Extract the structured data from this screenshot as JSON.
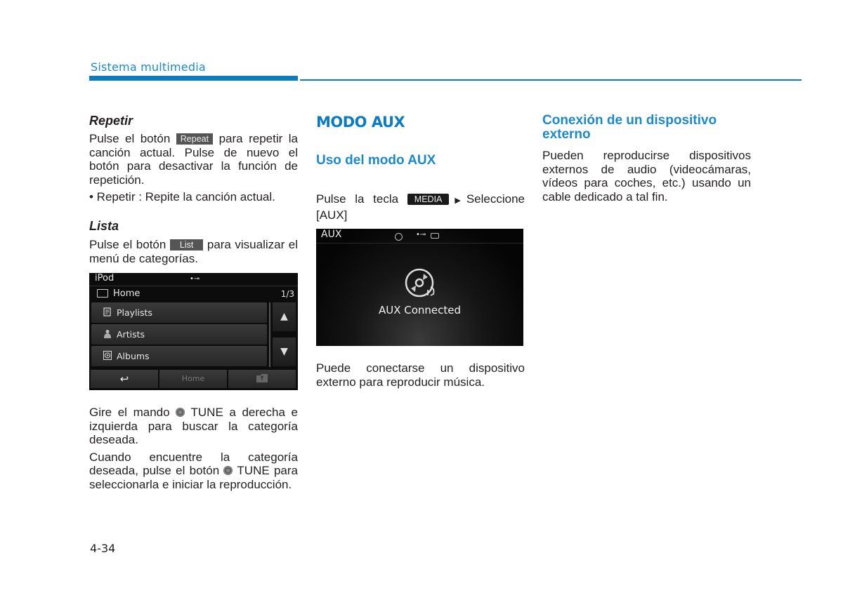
{
  "header": {
    "section_title": "Sistema multimedia",
    "accent_color": "#0a7cc2"
  },
  "left_column": {
    "repetir": {
      "heading": "Repetir",
      "text_before": "Pulse el botón",
      "button_label": "Repeat",
      "text_after": "para repetir la canción actual. Pulse de nuevo el botón para desactivar la función de repetición.",
      "bullet": "• Repetir : Repite la canción actual."
    },
    "lista": {
      "heading": "Lista",
      "text_before": "Pulse el botón",
      "button_label": "List",
      "text_after": "para visualizar el menú de categorías."
    },
    "ipod_screen": {
      "title": "iPod",
      "usb_icon": "usb-icon",
      "folder_label": "Home",
      "page_indicator": "1/3",
      "items": [
        {
          "label": "Playlists",
          "icon": "playlist-icon"
        },
        {
          "label": "Artists",
          "icon": "artist-icon"
        },
        {
          "label": "Albums",
          "icon": "album-icon"
        }
      ],
      "up_arrow": "▲",
      "down_arrow": "▼",
      "bottom_buttons": {
        "back": "↩",
        "home": "Home",
        "folder": "folder-up-icon"
      }
    },
    "gire": {
      "text_before": "Gire el mando",
      "knob": "TUNE",
      "text_after": "a derecha e izquierda para buscar la categoría deseada."
    },
    "cuando": {
      "text_before": "Cuando encuentre la categoría deseada, pulse el botón",
      "knob": "TUNE",
      "text_after": "para seleccionarla e iniciar la reproducción."
    }
  },
  "middle_column": {
    "title": "MODO AUX",
    "subtitle": "Uso del modo AUX",
    "instruction_before": "Pulse la tecla",
    "media_button": "MEDIA",
    "instruction_after": "Seleccione [AUX]",
    "aux_screen": {
      "title": "AUX",
      "status_icons": [
        "disc-icon",
        "usb-icon",
        "battery-icon"
      ],
      "message": "AUX Connected"
    },
    "caption": "Puede conectarse un dispositivo externo para reproducir música."
  },
  "right_column": {
    "heading": "Conexión de un dispositivo externo",
    "body": "Pueden reproducirse dispositivos externos de audio (videocámaras, vídeos para coches, etc.) usando un cable dedicado a tal fin."
  },
  "footer": {
    "page_number": "4-34"
  }
}
